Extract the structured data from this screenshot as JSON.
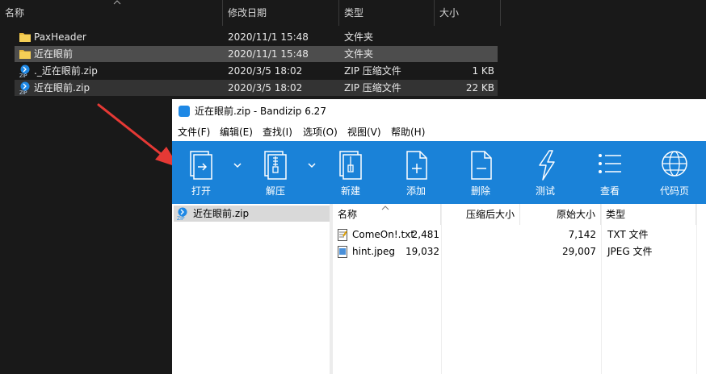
{
  "explorer": {
    "columns": {
      "name": "名称",
      "modified": "修改日期",
      "type": "类型",
      "size": "大小"
    },
    "rows": [
      {
        "name": "PaxHeader",
        "modified": "2020/11/1 15:48",
        "type": "文件夹",
        "size": "",
        "icon": "folder-icon"
      },
      {
        "name": "近在眼前",
        "modified": "2020/11/1 15:48",
        "type": "文件夹",
        "size": "",
        "icon": "folder-icon"
      },
      {
        "name": "._近在眼前.zip",
        "modified": "2020/3/5 18:02",
        "type": "ZIP 压缩文件",
        "size": "1 KB",
        "icon": "zip-icon"
      },
      {
        "name": "近在眼前.zip",
        "modified": "2020/3/5 18:02",
        "type": "ZIP 压缩文件",
        "size": "22 KB",
        "icon": "zip-icon"
      }
    ]
  },
  "bandizip": {
    "title": "近在眼前.zip - Bandizip 6.27",
    "menu": [
      "文件(F)",
      "编辑(E)",
      "查找(I)",
      "选项(O)",
      "视图(V)",
      "帮助(H)"
    ],
    "toolbar": [
      {
        "label": "打开",
        "icon": "open-icon"
      },
      {
        "label": "解压",
        "icon": "extract-icon"
      },
      {
        "label": "新建",
        "icon": "new-archive-icon"
      },
      {
        "label": "添加",
        "icon": "add-icon"
      },
      {
        "label": "删除",
        "icon": "delete-icon"
      },
      {
        "label": "测试",
        "icon": "test-icon"
      },
      {
        "label": "查看",
        "icon": "view-icon"
      },
      {
        "label": "代码页",
        "icon": "codepage-icon"
      }
    ],
    "tree": {
      "item": "近在眼前.zip"
    },
    "list": {
      "columns": {
        "name": "名称",
        "packed": "压缩后大小",
        "original": "原始大小",
        "type": "类型"
      },
      "rows": [
        {
          "name": "ComeOn!.txt",
          "packed": "2,481",
          "original": "7,142",
          "type": "TXT 文件",
          "icon": "text-file-icon"
        },
        {
          "name": "hint.jpeg",
          "packed": "19,032",
          "original": "29,007",
          "type": "JPEG 文件",
          "icon": "image-file-icon"
        }
      ]
    },
    "colors": {
      "toolbar": "#1a82d8",
      "selection": "#d9d9d9"
    }
  },
  "annotation": {
    "arrow_color": "#e53935",
    "icon": "red-arrow-icon"
  }
}
